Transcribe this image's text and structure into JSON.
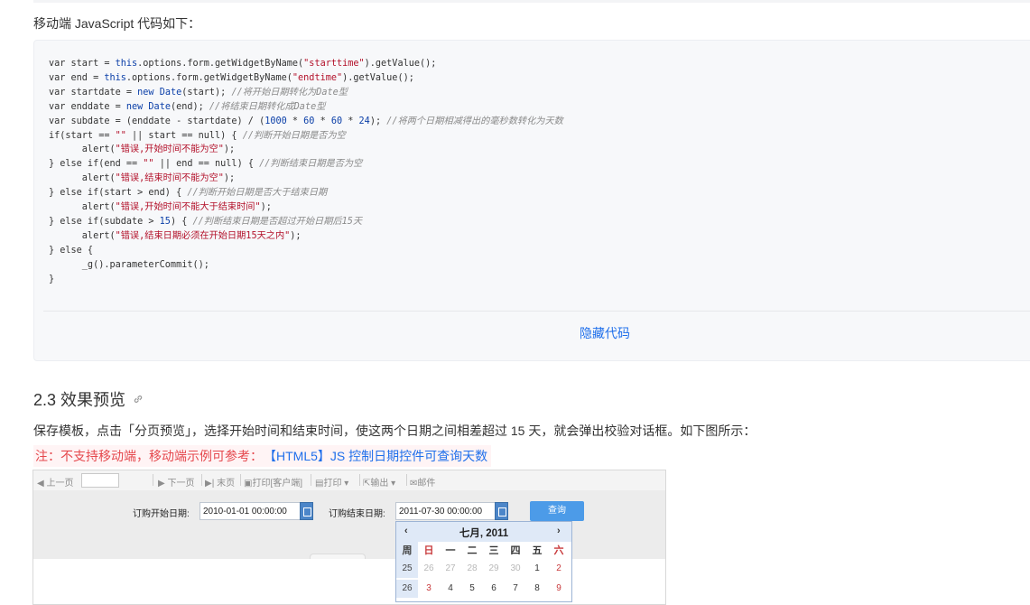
{
  "intro": "移动端 JavaScript 代码如下：",
  "code": {
    "lines": [
      [
        [
          "t",
          "var start = "
        ],
        [
          "k",
          "this"
        ],
        [
          "t",
          ".options.form.getWidgetByName("
        ],
        [
          "s",
          "\"starttime\""
        ],
        [
          "t",
          ").getValue();"
        ]
      ],
      [
        [
          "t",
          "var end = "
        ],
        [
          "k",
          "this"
        ],
        [
          "t",
          ".options.form.getWidgetByName("
        ],
        [
          "s",
          "\"endtime\""
        ],
        [
          "t",
          ").getValue();"
        ]
      ],
      [
        [
          "t",
          "var startdate = "
        ],
        [
          "k",
          "new"
        ],
        [
          "t",
          " "
        ],
        [
          "k",
          "Date"
        ],
        [
          "t",
          "(start); "
        ],
        [
          "c",
          "//将开始日期转化为Date型"
        ]
      ],
      [
        [
          "t",
          "var enddate = "
        ],
        [
          "k",
          "new"
        ],
        [
          "t",
          " "
        ],
        [
          "k",
          "Date"
        ],
        [
          "t",
          "(end); "
        ],
        [
          "c",
          "//将结束日期转化成Date型"
        ]
      ],
      [
        [
          "t",
          "var subdate = (enddate - startdate) / ("
        ],
        [
          "k",
          "1000"
        ],
        [
          "t",
          " * "
        ],
        [
          "k",
          "60"
        ],
        [
          "t",
          " * "
        ],
        [
          "k",
          "60"
        ],
        [
          "t",
          " * "
        ],
        [
          "k",
          "24"
        ],
        [
          "t",
          "); "
        ],
        [
          "c",
          "//将两个日期相减得出的毫秒数转化为天数"
        ]
      ],
      [
        [
          "t",
          "if(start == "
        ],
        [
          "s",
          "\"\""
        ],
        [
          "t",
          " || start == null) { "
        ],
        [
          "c",
          "//判断开始日期是否为空"
        ]
      ],
      [
        [
          "t",
          "      alert("
        ],
        [
          "s",
          "\"错误,开始时间不能为空\""
        ],
        [
          "t",
          ");"
        ]
      ],
      [
        [
          "t",
          "} else if(end == "
        ],
        [
          "s",
          "\"\""
        ],
        [
          "t",
          " || end == null) { "
        ],
        [
          "c",
          "//判断结束日期是否为空"
        ]
      ],
      [
        [
          "t",
          "      alert("
        ],
        [
          "s",
          "\"错误,结束时间不能为空\""
        ],
        [
          "t",
          ");"
        ]
      ],
      [
        [
          "t",
          "} else if(start > end) { "
        ],
        [
          "c",
          "//判断开始日期是否大于结束日期"
        ]
      ],
      [
        [
          "t",
          "      alert("
        ],
        [
          "s",
          "\"错误,开始时间不能大于结束时间\""
        ],
        [
          "t",
          ");"
        ]
      ],
      [
        [
          "t",
          "} else if(subdate > "
        ],
        [
          "k",
          "15"
        ],
        [
          "t",
          ") { "
        ],
        [
          "c",
          "//判断结束日期是否超过开始日期后15天"
        ]
      ],
      [
        [
          "t",
          "      alert("
        ],
        [
          "s",
          "\"错误,结束日期必须在开始日期15天之内\""
        ],
        [
          "t",
          ");"
        ]
      ],
      [
        [
          "t",
          "} else {"
        ]
      ],
      [
        [
          "t",
          "      _g().parameterCommit();"
        ]
      ],
      [
        [
          "t",
          "}"
        ]
      ]
    ],
    "hide_label": "隐藏代码"
  },
  "section": {
    "title": "2.3 效果预览"
  },
  "description": "保存模板，点击「分页预览」，选择开始时间和结束时间，使这两个日期之间相差超过 15 天，就会弹出校验对话框。如下图所示：",
  "note": {
    "label": "注：不支持移动端，移动端示例可参考：",
    "link": "【HTML5】JS 控制日期控件可查询天数"
  },
  "screenshot": {
    "toolbar": {
      "prev_page": "◀ 上一页",
      "next_page": "▶ 下一页",
      "last_page": "▶| 末页",
      "print_client": "打印[客户端]",
      "print": "打印 ▾",
      "export": "输出 ▾",
      "mail": "邮件"
    },
    "start_label": "订购开始日期:",
    "start_value": "2010-01-01 00:00:00",
    "end_label": "订购结束日期:",
    "end_value": "2011-07-30 00:00:00",
    "query_button": "查询",
    "calendar": {
      "prev": "‹",
      "next": "›",
      "month_title": "七月, 2011",
      "week_header": "周",
      "days_of_week": [
        "日",
        "一",
        "二",
        "三",
        "四",
        "五",
        "六"
      ],
      "weeks": [
        {
          "week": "25",
          "days": [
            "26",
            "27",
            "28",
            "29",
            "30",
            "1",
            "2"
          ]
        },
        {
          "week": "26",
          "days": [
            "3",
            "4",
            "5",
            "6",
            "7",
            "8",
            "9"
          ]
        }
      ]
    }
  }
}
